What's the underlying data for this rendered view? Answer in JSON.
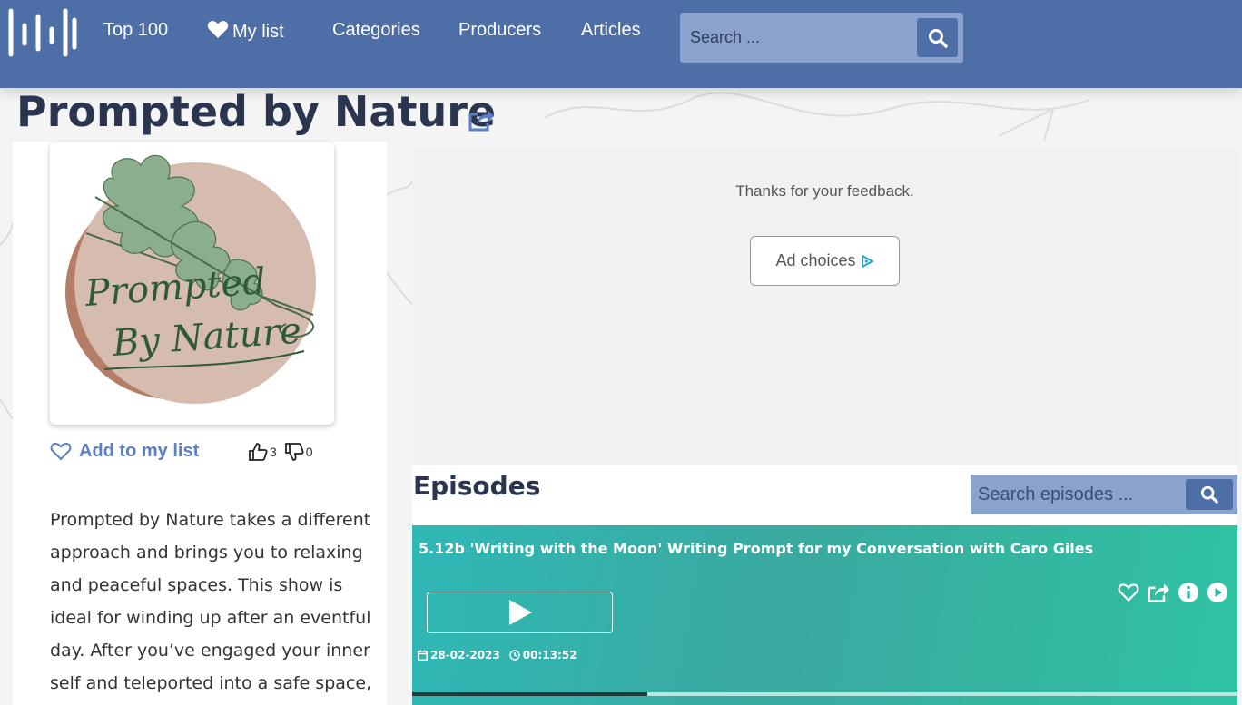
{
  "header": {
    "nav": {
      "top100": "Top 100",
      "mylist": "My list",
      "categories": "Categories",
      "producers": "Producers",
      "articles": "Articles"
    },
    "search_placeholder": "Search ..."
  },
  "podcast": {
    "title": "Prompted by Nature",
    "add_to_list": "Add to my list",
    "likes": "3",
    "dislikes": "0",
    "cover_text_line1": "Prompted",
    "cover_text_line2": "By Nature",
    "description": "Prompted by Nature takes a different approach and brings you to relaxing and peaceful spaces. This show is ideal for winding up after an eventful day. After you’ve engaged your inner self and teleported into a safe space,"
  },
  "ad": {
    "feedback_text": "Thanks for your feedback.",
    "choices_label": "Ad choices"
  },
  "episodes": {
    "heading": "Episodes",
    "search_placeholder": "Search episodes ...",
    "items": [
      {
        "title": "5.12b 'Writing with the Moon' Writing Prompt for my Conversation with Caro Giles",
        "date": "28-02-2023",
        "duration": "00:13:52",
        "progress": 0.285
      }
    ]
  },
  "colors": {
    "header": "#4e6ea8",
    "accent": "#5a7fc4",
    "episode_card": "#2fb8b6"
  }
}
